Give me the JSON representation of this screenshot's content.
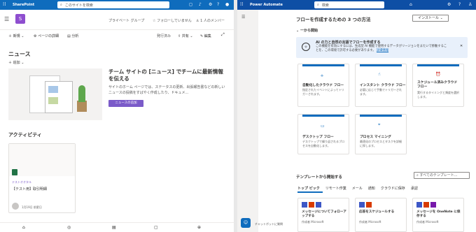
{
  "sharepoint": {
    "app_name": "SharePoint",
    "search_placeholder": "このサイトを検索",
    "site_letter": "S",
    "site_meta": {
      "group": "プライベート グループ",
      "follow": "フォローしていません",
      "members": "1 人のメンバー"
    },
    "toolbar": {
      "new": "新規",
      "page_details": "ページの詳細",
      "analytics": "分析",
      "published": "発行済み",
      "share": "共有",
      "edit": "編集"
    },
    "news": {
      "title": "ニュース",
      "add": "追加",
      "headline": "チーム サイトの [ニュース] でチームに最新情報を伝える",
      "body": "サイトのホーム ページでは、ステータスの更新、出張報告書などの新しいニュースの投稿をすばやく作成したり、ドキュメ...",
      "button": "ニュースの追加"
    },
    "activity": {
      "title": "アクティビティ",
      "doc_tag": "テストオオタル",
      "doc_title": "【テスト用】取引明細",
      "date": "1月19日 前更日"
    },
    "bottom_nav": [
      "home-icon",
      "globe-icon",
      "news-icon",
      "files-icon",
      "add-icon"
    ]
  },
  "power_automate": {
    "app_name": "Power Automate",
    "search_placeholder": "検索",
    "heading": "フローを作成するための 3 つの方法",
    "install_label": "インストール",
    "start_blank": "一から開始",
    "ai_banner": {
      "title": "AI の力と自然の言語でフローを作成する",
      "body": "この機能を有効にするには、生成型 AI 機能で使用するデータがリージョンをまたいで移動することを、この環境で許可する必要があります。",
      "link": "詳細情報"
    },
    "flow_cards": [
      {
        "title": "自動化したクラウド フロー",
        "desc": "指定されたイベントによってトリガーされます。"
      },
      {
        "title": "インスタント クラウド フロー",
        "desc": "必要に応じて手動でトリガーされます。"
      },
      {
        "title": "スケジュール済みクラウド フロー",
        "desc": "実行するタイミングと頻度を選択します。"
      },
      {
        "title": "デスクトップ フロー",
        "desc": "デスクトップで繰り返されるプロセスを自動化します。"
      },
      {
        "title": "プロセス マイニング",
        "desc": "最適化のプロセスとタスクを詳細に探します。"
      }
    ],
    "templates": {
      "title": "テンプレートから開始する",
      "search_placeholder": "すべてのテンプレート...",
      "tabs": [
        "トップ ピック",
        "リモート作業",
        "メール",
        "通知",
        "クラウドに保存",
        "承認"
      ],
      "cards": [
        {
          "title": "メッセージについてフォローアップする",
          "by": "作成者 Microsoft"
        },
        {
          "title": "応答をスケジュールする",
          "by": "作成者 Microsoft"
        },
        {
          "title": "メッセージを OneNote に保存する",
          "by": "作成者 Microsoft"
        }
      ]
    },
    "chatbot_label": "チャットボットに質問"
  },
  "colors": {
    "sp_blue": "#0f6cbd",
    "pa_blue": "#0e4fa5",
    "sp_accent": "#7b5bc9",
    "site_tile": "#8e4ecf"
  }
}
